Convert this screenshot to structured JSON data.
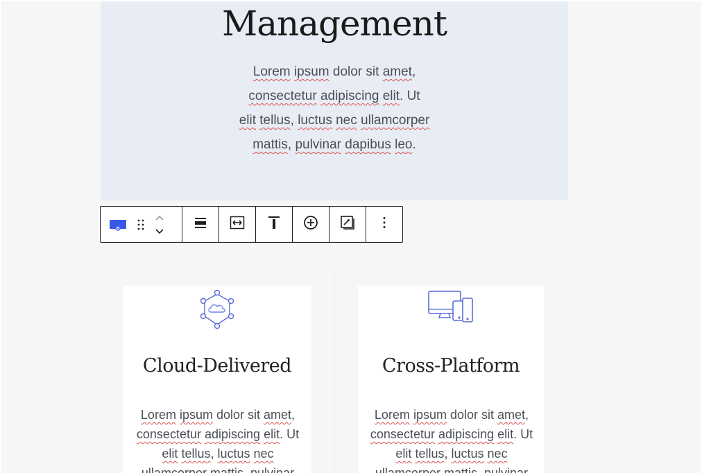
{
  "hero": {
    "title": "Management",
    "text_lines": [
      [
        {
          "t": "Lorem",
          "s": true
        },
        {
          "t": " "
        },
        {
          "t": "ipsum",
          "s": true
        },
        {
          "t": " dolor sit "
        },
        {
          "t": "amet",
          "s": true
        },
        {
          "t": ","
        }
      ],
      [
        {
          "t": "consectetur",
          "s": true
        },
        {
          "t": " "
        },
        {
          "t": "adipiscing",
          "s": true
        },
        {
          "t": " "
        },
        {
          "t": "elit",
          "s": true
        },
        {
          "t": ". Ut"
        }
      ],
      [
        {
          "t": "elit",
          "s": true
        },
        {
          "t": " "
        },
        {
          "t": "tellus",
          "s": true
        },
        {
          "t": ", "
        },
        {
          "t": "luctus",
          "s": true
        },
        {
          "t": " "
        },
        {
          "t": "nec",
          "s": true
        },
        {
          "t": " "
        },
        {
          "t": "ullamcorper",
          "s": true
        }
      ],
      [
        {
          "t": "mattis",
          "s": true
        },
        {
          "t": ", "
        },
        {
          "t": "pulvinar",
          "s": true
        },
        {
          "t": " "
        },
        {
          "t": "dapibus",
          "s": true
        },
        {
          "t": " "
        },
        {
          "t": "leo",
          "s": true
        },
        {
          "t": "."
        }
      ]
    ]
  },
  "toolbar": {
    "buttons": [
      {
        "name": "block-type-icon",
        "icon": "cover-block-icon"
      },
      {
        "name": "drag-handle",
        "icon": "drag-handle-icon"
      },
      {
        "name": "move-up-down",
        "icon": "chevron-up-down-icon"
      },
      {
        "name": "align-button",
        "icon": "align-wide-icon"
      },
      {
        "name": "width-button",
        "icon": "full-width-icon"
      },
      {
        "name": "vertical-align-button",
        "icon": "align-top-icon"
      },
      {
        "name": "add-button",
        "icon": "plus-circle-icon"
      },
      {
        "name": "replace-button",
        "icon": "edit-frame-icon"
      },
      {
        "name": "more-options-button",
        "icon": "more-vertical-icon"
      }
    ],
    "accent": "#3858e9"
  },
  "cards": [
    {
      "title": "Cloud-Delivered",
      "icon": "cloud-network-icon",
      "text_lines": [
        [
          {
            "t": "Lorem",
            "s": true
          },
          {
            "t": " "
          },
          {
            "t": "ipsum",
            "s": true
          },
          {
            "t": " dolor sit "
          },
          {
            "t": "amet",
            "s": true
          },
          {
            "t": ","
          }
        ],
        [
          {
            "t": "consectetur",
            "s": true
          },
          {
            "t": " "
          },
          {
            "t": "adipiscing",
            "s": true
          },
          {
            "t": " "
          },
          {
            "t": "elit",
            "s": true
          },
          {
            "t": ". Ut"
          }
        ],
        [
          {
            "t": "elit",
            "s": true
          },
          {
            "t": " "
          },
          {
            "t": "tellus",
            "s": true
          },
          {
            "t": ", "
          },
          {
            "t": "luctus",
            "s": true
          },
          {
            "t": " "
          },
          {
            "t": "nec",
            "s": true
          }
        ],
        [
          {
            "t": "ullamcorper",
            "s": true
          },
          {
            "t": " "
          },
          {
            "t": "mattis",
            "s": true
          },
          {
            "t": ", "
          },
          {
            "t": "pulvinar",
            "s": true
          }
        ]
      ]
    },
    {
      "title": "Cross-Platform",
      "icon": "devices-icon",
      "text_lines": [
        [
          {
            "t": "Lorem",
            "s": true
          },
          {
            "t": " "
          },
          {
            "t": "ipsum",
            "s": true
          },
          {
            "t": " dolor sit "
          },
          {
            "t": "amet",
            "s": true
          },
          {
            "t": ","
          }
        ],
        [
          {
            "t": "consectetur",
            "s": true
          },
          {
            "t": " "
          },
          {
            "t": "adipiscing",
            "s": true
          },
          {
            "t": " "
          },
          {
            "t": "elit",
            "s": true
          },
          {
            "t": ". Ut"
          }
        ],
        [
          {
            "t": "elit",
            "s": true
          },
          {
            "t": " "
          },
          {
            "t": "tellus",
            "s": true
          },
          {
            "t": ", "
          },
          {
            "t": "luctus",
            "s": true
          },
          {
            "t": " "
          },
          {
            "t": "nec",
            "s": true
          }
        ],
        [
          {
            "t": "ullamcorper",
            "s": true
          },
          {
            "t": " "
          },
          {
            "t": "mattis",
            "s": true
          },
          {
            "t": ", "
          },
          {
            "t": "pulvinar",
            "s": true
          }
        ]
      ]
    }
  ]
}
